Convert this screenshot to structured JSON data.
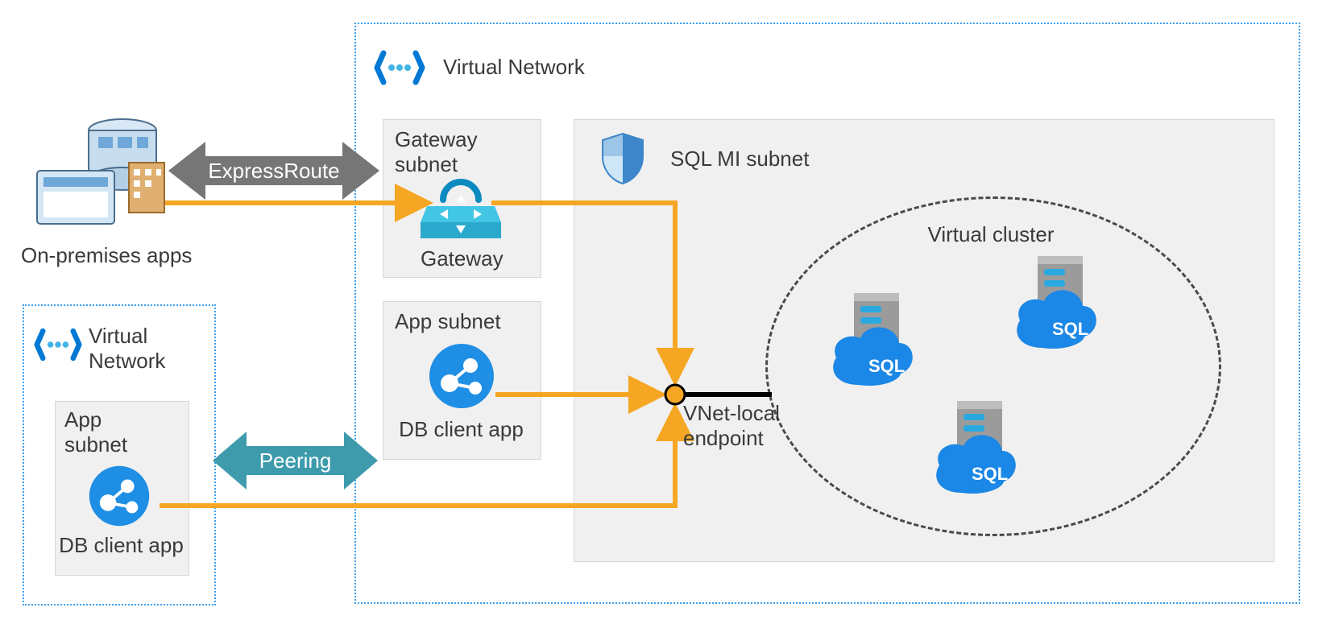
{
  "labels": {
    "vnet_main": "Virtual Network",
    "vnet_left": "Virtual\nNetwork",
    "on_prem": "On-premises apps",
    "gateway_subnet": "Gateway\nsubnet",
    "gateway": "Gateway",
    "app_subnet_main": "App subnet",
    "db_client_app_main": "DB client app",
    "app_subnet_left": "App\nsubnet",
    "db_client_app_left": "DB client app",
    "sql_mi_subnet": "SQL MI subnet",
    "virtual_cluster": "Virtual cluster",
    "endpoint": "VNet-local\nendpoint",
    "express_route": "ExpressRoute",
    "peering": "Peering",
    "sql": "SQL"
  },
  "colors": {
    "dotted_border": "#3aa0f3",
    "grey_box_bg": "#f0f0f0",
    "grey_box_border": "#d7d7d7",
    "arrow_grey": "#767676",
    "arrow_teal": "#3d9bac",
    "flow_orange": "#f5a623",
    "azure_blue_light": "#42b4e6",
    "azure_blue_dark": "#0078d4",
    "sql_badge": "#1b87e6",
    "server_grey": "#828282",
    "black": "#000000"
  }
}
